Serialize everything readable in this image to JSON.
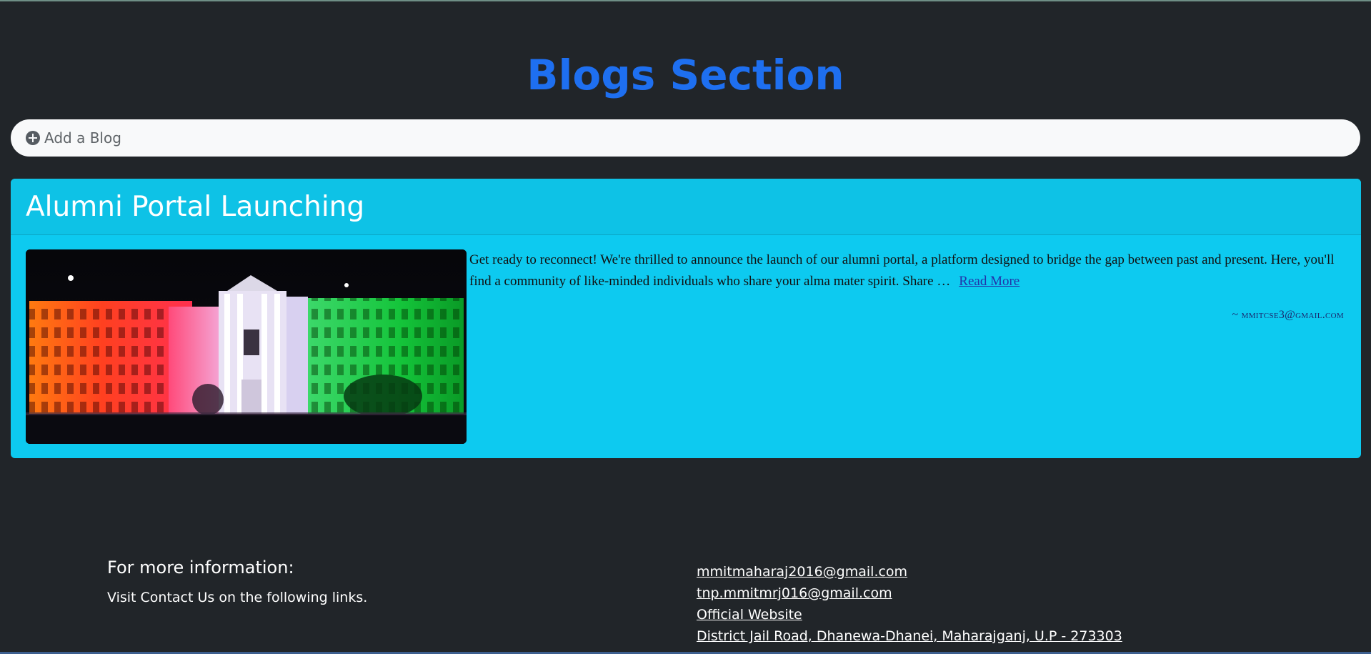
{
  "page": {
    "title": "Blogs Section"
  },
  "add_blog": {
    "label": "Add a Blog",
    "icon": "plus-circle-icon"
  },
  "blog_post": {
    "title": "Alumni Portal Launching",
    "excerpt": "Get ready to reconnect! We're thrilled to announce the launch of our alumni portal, a platform designed to bridge the gap between past and present. Here, you'll find a community of like-minded individuals who share your alma mater spirit. Share …",
    "read_more_label": "Read More",
    "author": "~ mmitcse3@gmail.com",
    "image_alt": "College building illuminated in saffron, white and green",
    "colors": {
      "card_bg": "#0dcaf0",
      "title": "#ffffff"
    }
  },
  "footer": {
    "heading": "For more information:",
    "subtext": "Visit Contact Us on the following links.",
    "links": [
      "mmitmaharaj2016@gmail.com",
      "tnp.mmitmrj016@gmail.com",
      "Official Website",
      "District Jail Road, Dhanewa-Dhanei, Maharajganj, U.P - 273303"
    ]
  },
  "colors": {
    "background": "#212529",
    "accent": "#1e6ff0"
  }
}
